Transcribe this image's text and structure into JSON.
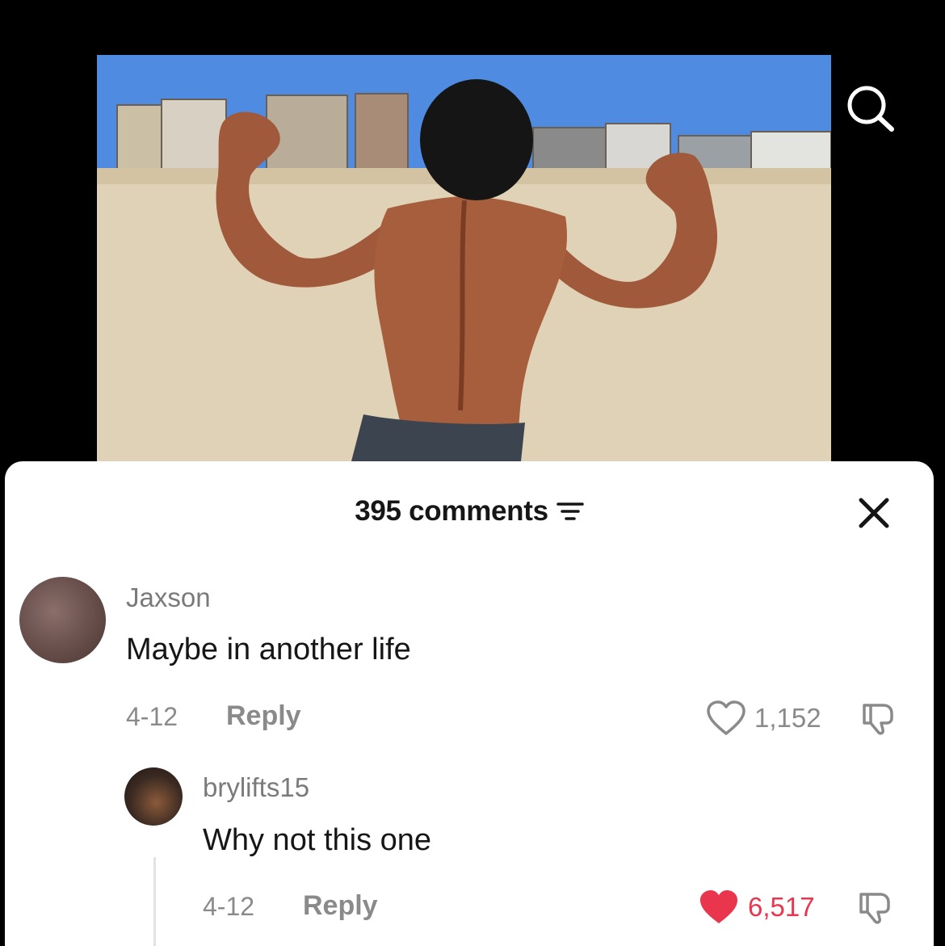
{
  "sheet": {
    "comments_count": "395 comments",
    "filter_icon": "filter-icon",
    "close_icon": "close-icon"
  },
  "header": {
    "search_icon": "search-icon"
  },
  "comments": [
    {
      "username": "Jaxson",
      "text": "Maybe in another life",
      "date": "4-12",
      "reply_label": "Reply",
      "likes": "1,152",
      "liked": false
    },
    {
      "username": "brylifts15",
      "text": "Why not this one",
      "date": "4-12",
      "reply_label": "Reply",
      "likes": "6,517",
      "liked": true
    }
  ],
  "colors": {
    "liked": "#e9364d",
    "muted_text": "#8a8a8a",
    "primary_text": "#161616",
    "background": "#000000",
    "sheet": "#ffffff"
  }
}
